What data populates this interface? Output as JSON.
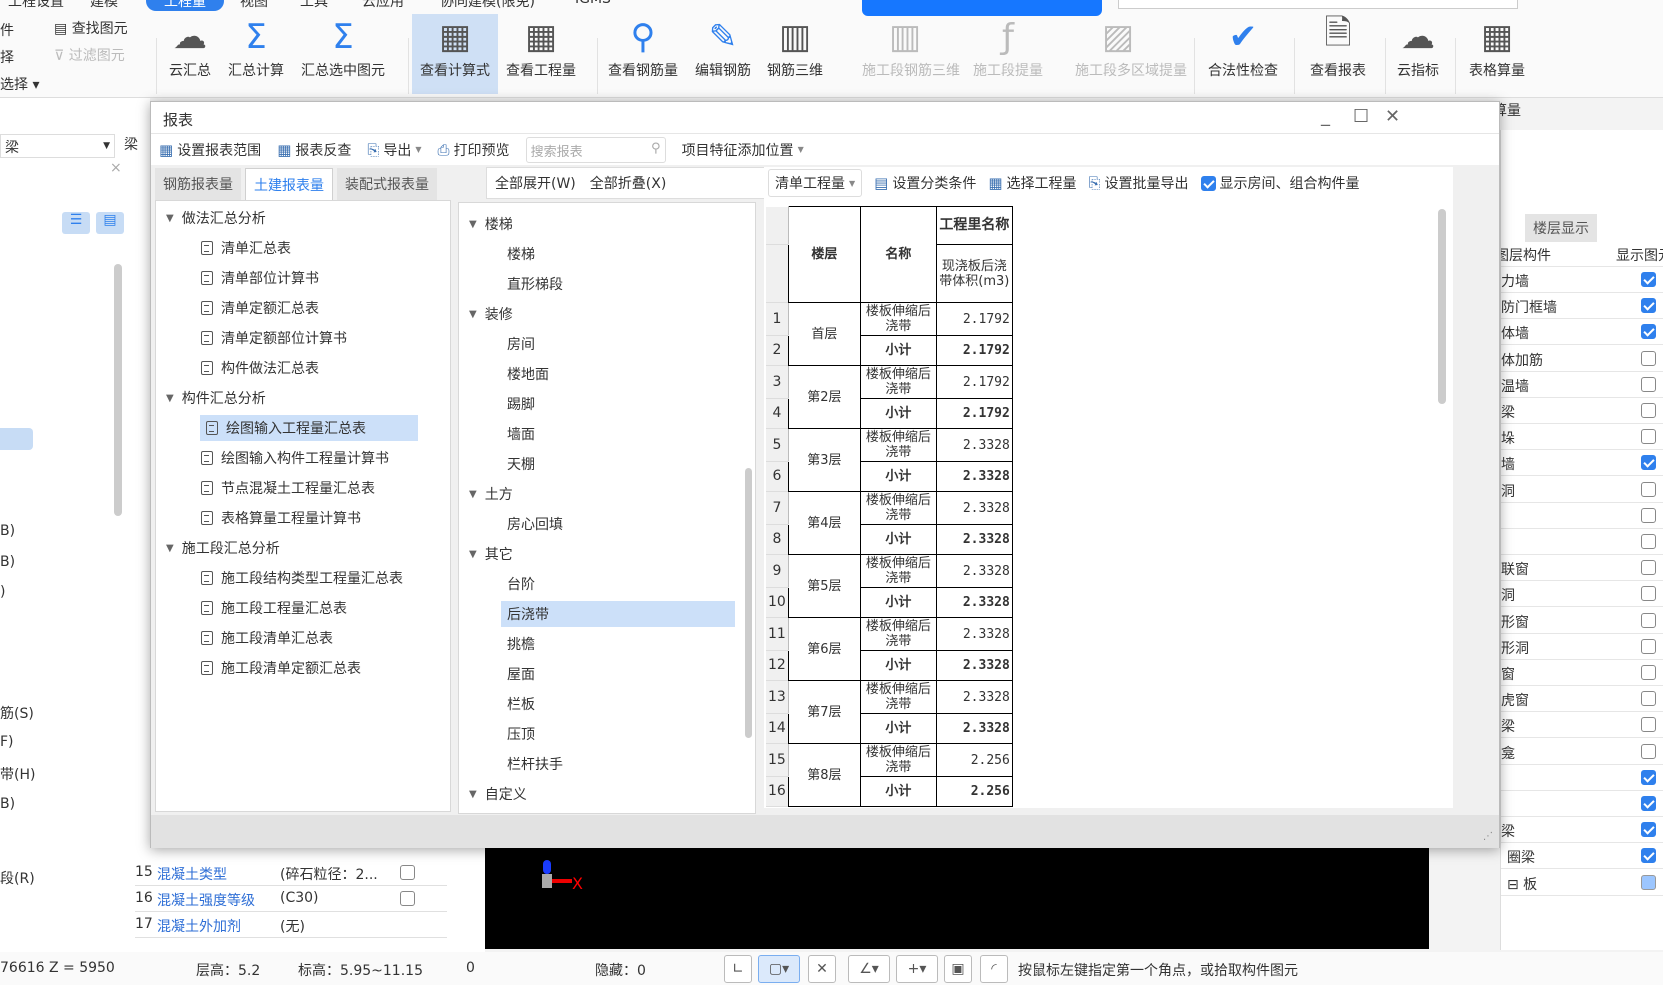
{
  "ribbon_tabs": [
    {
      "label": "工程设置"
    },
    {
      "label": "建模"
    },
    {
      "label": "工程量",
      "active": true
    },
    {
      "label": "视图"
    },
    {
      "label": "工具"
    },
    {
      "label": "云应用"
    },
    {
      "label": "协同建模(限免)"
    },
    {
      "label": "IGMS"
    }
  ],
  "ribbon_left": {
    "items": [
      "件",
      "择",
      "选择 ▾",
      "选择"
    ],
    "find": "查找图元",
    "filter": "过滤图元"
  },
  "ribbon_buttons": [
    {
      "label": "云汇总",
      "icon": "cloud-sum-icon",
      "glyph": "☁"
    },
    {
      "label": "汇总计算",
      "icon": "sigma-icon",
      "glyph": "Σ"
    },
    {
      "label": "汇总选中图元",
      "icon": "sigma-select-icon",
      "glyph": "Σ"
    },
    {
      "label": "查看计算式",
      "icon": "formula-view-icon",
      "glyph": "▦",
      "active": true
    },
    {
      "label": "查看工程量",
      "icon": "quantity-view-icon",
      "glyph": "▦"
    },
    {
      "label": "查看钢筋量",
      "icon": "rebar-view-icon",
      "glyph": "⚲"
    },
    {
      "label": "编辑钢筋",
      "icon": "rebar-edit-icon",
      "glyph": "✎"
    },
    {
      "label": "钢筋三维",
      "icon": "rebar-3d-icon",
      "glyph": "▥"
    },
    {
      "label": "施工段钢筋三维",
      "icon": "stage-rebar-3d-icon",
      "glyph": "▥",
      "disabled": true
    },
    {
      "label": "施工段提量",
      "icon": "stage-quantity-icon",
      "glyph": "ƒ",
      "disabled": true
    },
    {
      "label": "施工段多区域提量",
      "icon": "stage-multi-icon",
      "glyph": "▨",
      "disabled": true
    },
    {
      "label": "合法性检查",
      "icon": "check-icon",
      "glyph": "✔"
    },
    {
      "label": "查看报表",
      "icon": "report-view-icon",
      "glyph": "🗎"
    },
    {
      "label": "云指标",
      "icon": "cloud-index-icon",
      "glyph": "☁"
    },
    {
      "label": "表格算量",
      "icon": "table-calc-icon",
      "glyph": "▦"
    }
  ],
  "background": {
    "left_select": "梁",
    "left_select2": "梁",
    "right_tab": "楼层显示",
    "right_header_col1": "图层构件",
    "right_header_col2": "显示图元",
    "right_under_label": "算量"
  },
  "dialog": {
    "title": "报表",
    "toolbar": {
      "set_range": "设置报表范围",
      "reverse": "报表反查",
      "export": "导出",
      "print": "打印预览",
      "search_placeholder": "搜索报表",
      "feature_pos": "项目特征添加位置"
    },
    "tabs": [
      {
        "label": "钢筋报表量"
      },
      {
        "label": "土建报表量",
        "active": true
      },
      {
        "label": "装配式报表量"
      }
    ],
    "report_tree": [
      {
        "label": "做法汇总分析",
        "group": true
      },
      {
        "label": "清单汇总表"
      },
      {
        "label": "清单部位计算书"
      },
      {
        "label": "清单定额汇总表"
      },
      {
        "label": "清单定额部位计算书"
      },
      {
        "label": "构件做法汇总表"
      },
      {
        "label": "构件汇总分析",
        "group": true
      },
      {
        "label": "绘图输入工程量汇总表",
        "selected": true
      },
      {
        "label": "绘图输入构件工程量计算书"
      },
      {
        "label": "节点混凝土工程量汇总表"
      },
      {
        "label": "表格算量工程量计算书"
      },
      {
        "label": "施工段汇总分析",
        "group": true
      },
      {
        "label": "施工段结构类型工程量汇总表"
      },
      {
        "label": "施工段工程量汇总表"
      },
      {
        "label": "施工段清单汇总表"
      },
      {
        "label": "施工段清单定额汇总表"
      }
    ],
    "mid": {
      "expand_all": "全部展开(W)",
      "collapse_all": "全部折叠(X)"
    },
    "component_tree": [
      {
        "label": "楼梯",
        "group": true
      },
      {
        "label": "楼梯"
      },
      {
        "label": "直形梯段"
      },
      {
        "label": "装修",
        "group": true
      },
      {
        "label": "房间"
      },
      {
        "label": "楼地面"
      },
      {
        "label": "踢脚"
      },
      {
        "label": "墙面"
      },
      {
        "label": "天棚"
      },
      {
        "label": "土方",
        "group": true
      },
      {
        "label": "房心回填"
      },
      {
        "label": "其它",
        "group": true
      },
      {
        "label": "台阶"
      },
      {
        "label": "后浇带",
        "selected": true
      },
      {
        "label": "挑檐"
      },
      {
        "label": "屋面"
      },
      {
        "label": "栏板"
      },
      {
        "label": "压顶"
      },
      {
        "label": "栏杆扶手"
      },
      {
        "label": "自定义",
        "group": true
      }
    ],
    "right_toolbar": {
      "qty_select": "清单工程量",
      "set_class": "设置分类条件",
      "select_qty": "选择工程量",
      "batch_export": "设置批量导出",
      "show_rooms": "显示房间、组合构件量",
      "show_rooms_checked": true
    },
    "table": {
      "headers": {
        "floor": "楼层",
        "name": "名称",
        "qty_name": "工程里名称",
        "qty_col": "现浇板后浇带体积(m3)"
      },
      "floors": [
        {
          "floor": "首层",
          "name": "楼板伸缩后浇带",
          "value": "2.1792",
          "subtotal_label": "小计",
          "subtotal": "2.1792"
        },
        {
          "floor": "第2层",
          "name": "楼板伸缩后浇带",
          "value": "2.1792",
          "subtotal_label": "小计",
          "subtotal": "2.1792"
        },
        {
          "floor": "第3层",
          "name": "楼板伸缩后浇带",
          "value": "2.3328",
          "subtotal_label": "小计",
          "subtotal": "2.3328"
        },
        {
          "floor": "第4层",
          "name": "楼板伸缩后浇带",
          "value": "2.3328",
          "subtotal_label": "小计",
          "subtotal": "2.3328"
        },
        {
          "floor": "第5层",
          "name": "楼板伸缩后浇带",
          "value": "2.3328",
          "subtotal_label": "小计",
          "subtotal": "2.3328"
        },
        {
          "floor": "第6层",
          "name": "楼板伸缩后浇带",
          "value": "2.3328",
          "subtotal_label": "小计",
          "subtotal": "2.3328"
        },
        {
          "floor": "第7层",
          "name": "楼板伸缩后浇带",
          "value": "2.3328",
          "subtotal_label": "小计",
          "subtotal": "2.3328"
        },
        {
          "floor": "第8层",
          "name": "楼板伸缩后浇带",
          "value": "2.256",
          "subtotal_label": "小计",
          "subtotal": "2.256"
        }
      ]
    }
  },
  "layer_list": [
    {
      "label": "力墙",
      "checked": true
    },
    {
      "label": "防门框墙",
      "checked": true
    },
    {
      "label": "体墙",
      "checked": true
    },
    {
      "label": "体加筋",
      "checked": false
    },
    {
      "label": "温墙",
      "checked": false
    },
    {
      "label": "梁",
      "checked": false
    },
    {
      "label": "垛",
      "checked": false
    },
    {
      "label": "墙",
      "checked": true
    },
    {
      "label": "洞",
      "checked": false
    },
    {
      "label": "",
      "checked": false
    },
    {
      "label": "",
      "checked": false
    },
    {
      "label": "联窗",
      "checked": false
    },
    {
      "label": "洞",
      "checked": false
    },
    {
      "label": "形窗",
      "checked": false
    },
    {
      "label": "形洞",
      "checked": false
    },
    {
      "label": "窗",
      "checked": false
    },
    {
      "label": "虎窗",
      "checked": false
    },
    {
      "label": "梁",
      "checked": false
    },
    {
      "label": "龛",
      "checked": false
    },
    {
      "label": "",
      "checked": true
    },
    {
      "label": "",
      "checked": true
    },
    {
      "label": "梁",
      "checked": true
    },
    {
      "label": "圈梁",
      "checked": true
    },
    {
      "label": "⊟ 板",
      "checked": "partial"
    }
  ],
  "properties": [
    {
      "no": "15",
      "name": "混凝土类型",
      "value": "(碎石粒径：2...",
      "checkbox": true
    },
    {
      "no": "16",
      "name": "混凝土强度等级",
      "value": "(C30)",
      "checkbox": true
    },
    {
      "no": "17",
      "name": "混凝土外加剂",
      "value": "(无)",
      "checkbox": false
    }
  ],
  "left_fragments": [
    "B)",
    "B)",
    ")",
    "筋(S)",
    "F)",
    "带(H)",
    "B)",
    "段(R)"
  ],
  "viewport": {
    "axis_x": "X"
  },
  "status": {
    "coord": "76616 Z = 5950",
    "floor_height": "层高：5.2",
    "elevation": "标高：5.95~11.15",
    "zero": "0",
    "hidden": "隐藏：0",
    "hint": "按鼠标左键指定第一个角点，或拾取构件图元"
  },
  "colors": {
    "accent": "#2f80ed",
    "highlight": "#cce0f9",
    "link": "#2f6fd6"
  }
}
